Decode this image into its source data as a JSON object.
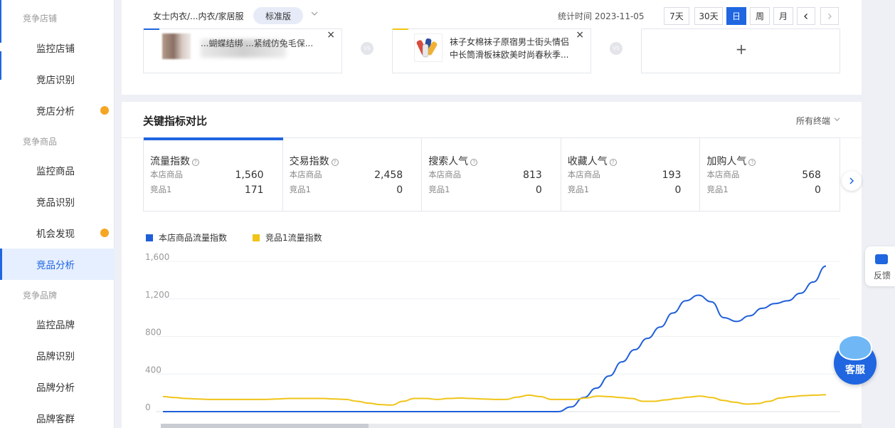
{
  "sidebar": {
    "groups": [
      "竞争店铺",
      "竞争商品",
      "竞争品牌"
    ],
    "items": [
      {
        "label": "监控店铺",
        "dot": false,
        "active": false
      },
      {
        "label": "竞店识别",
        "dot": false,
        "active": false
      },
      {
        "label": "竞店分析",
        "dot": true,
        "active": false
      },
      {
        "label": "监控商品",
        "dot": false,
        "active": false
      },
      {
        "label": "竞品识别",
        "dot": false,
        "active": false
      },
      {
        "label": "机会发现",
        "dot": true,
        "active": false
      },
      {
        "label": "竞品分析",
        "dot": false,
        "active": true
      },
      {
        "label": "监控品牌",
        "dot": false,
        "active": false
      },
      {
        "label": "品牌识别",
        "dot": false,
        "active": false
      },
      {
        "label": "品牌分析",
        "dot": false,
        "active": false
      },
      {
        "label": "品牌客群",
        "dot": false,
        "active": false
      }
    ]
  },
  "header": {
    "category": "女士内衣/...内衣/家居服",
    "edition": "标准版",
    "stat_time_label": "统计时间 2023-11-05",
    "periods": [
      "7天",
      "30天",
      "日",
      "周",
      "月"
    ],
    "active_period": "日"
  },
  "compare": {
    "product1_text": "...蝴蝶结绑 ...紧绒仿兔毛保...",
    "product2_text": [
      "袜子女棉袜子原宿男士街头情侣",
      "中长筒滑板袜欧美时尚春秋季..."
    ],
    "vs_label": "VS",
    "add_label": "+",
    "close_label": "×"
  },
  "metrics_section": {
    "title": "关键指标对比",
    "terminal": "所有终端",
    "row1_label": "本店商品",
    "row2_label": "竞品1",
    "help_glyph": "?",
    "items": [
      {
        "name": "流量指数",
        "v1": "1,560",
        "v2": "171"
      },
      {
        "name": "交易指数",
        "v1": "2,458",
        "v2": "0"
      },
      {
        "name": "搜索人气",
        "v1": "813",
        "v2": "0"
      },
      {
        "name": "收藏人气",
        "v1": "193",
        "v2": "0"
      },
      {
        "name": "加购人气",
        "v1": "568",
        "v2": "0"
      }
    ]
  },
  "chart_data": {
    "type": "line",
    "series": [
      {
        "name": "本店商品流量指数",
        "color": "#1f5fd9",
        "values": [
          0,
          0,
          0,
          0,
          0,
          0,
          0,
          0,
          0,
          0,
          0,
          0,
          0,
          0,
          0,
          0,
          0,
          0,
          0,
          0,
          0,
          0,
          0,
          0,
          0,
          0,
          0,
          0,
          0,
          0,
          0,
          0,
          50,
          150,
          250,
          380,
          530,
          660,
          780,
          900,
          1050,
          1180,
          1240,
          1170,
          1000,
          960,
          1020,
          1100,
          1150,
          1180,
          1260,
          1380,
          1550
        ]
      },
      {
        "name": "竞品1流量指数",
        "color": "#f0c419",
        "values": [
          160,
          150,
          140,
          135,
          130,
          130,
          130,
          130,
          130,
          130,
          135,
          140,
          140,
          140,
          140,
          135,
          130,
          110,
          90,
          75,
          70,
          110,
          140,
          140,
          130,
          140,
          145,
          140,
          135,
          130,
          130,
          155,
          175,
          160,
          130,
          130,
          130,
          145,
          165,
          160,
          150,
          140,
          110,
          110,
          125,
          140,
          155,
          165,
          150,
          120,
          100,
          80,
          85,
          110,
          145,
          160,
          170,
          175,
          180
        ]
      }
    ],
    "y_ticks": [
      "0",
      "400",
      "800",
      "1,200",
      "1,600"
    ],
    "ylim": [
      0,
      1600
    ],
    "grid": true,
    "legend": "top-left"
  },
  "feedback_label": "反馈",
  "service_label": "客服"
}
